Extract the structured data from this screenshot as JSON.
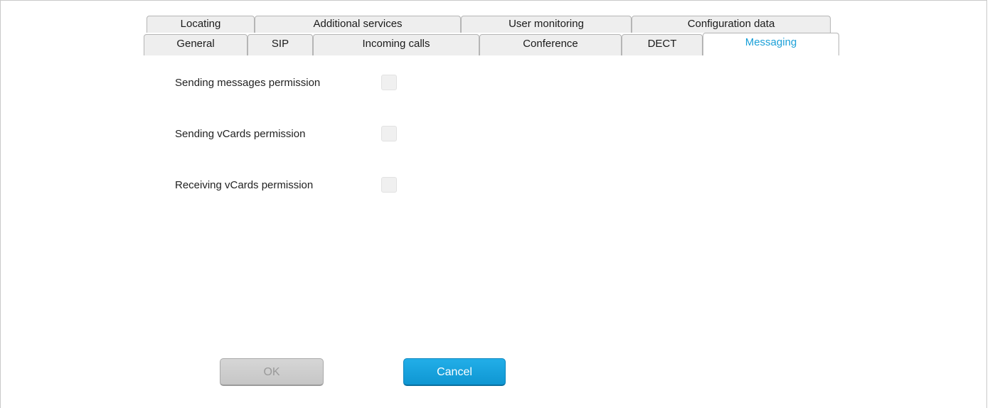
{
  "tabs": {
    "row1": [
      {
        "label": "Locating"
      },
      {
        "label": "Additional services"
      },
      {
        "label": "User monitoring"
      },
      {
        "label": "Configuration data"
      }
    ],
    "row2": [
      {
        "label": "General"
      },
      {
        "label": "SIP"
      },
      {
        "label": "Incoming calls"
      },
      {
        "label": "Conference"
      },
      {
        "label": "DECT"
      },
      {
        "label": "Messaging",
        "active": true
      }
    ]
  },
  "fields": [
    {
      "label": "Sending messages permission",
      "checked": false
    },
    {
      "label": "Sending vCards permission",
      "checked": false
    },
    {
      "label": "Receiving vCards permission",
      "checked": false
    }
  ],
  "buttons": {
    "ok_label": "OK",
    "cancel_label": "Cancel",
    "ok_enabled": false
  },
  "colors": {
    "active_tab_text": "#1ba0d8",
    "cancel_button": "#1ba0d8",
    "ok_disabled": "#c9c9c9"
  }
}
